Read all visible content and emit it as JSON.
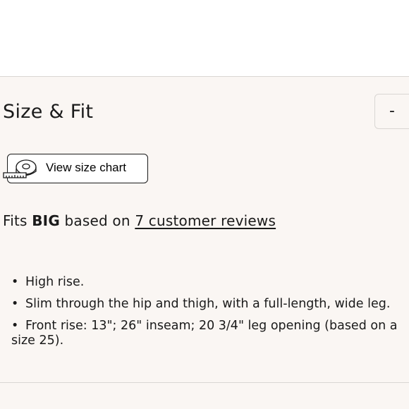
{
  "size_fit": {
    "title": "Size & Fit",
    "toggle_label": "-",
    "size_chart_button": {
      "label": "View size chart",
      "icon": "measuring-tape-icon"
    },
    "fit_summary": {
      "prefix": "Fits",
      "fit_value": "BIG",
      "middle": "based on",
      "reviews_link": "7 customer reviews"
    },
    "features": [
      "High rise.",
      "Slim through the hip and thigh, with a full-length, wide leg.",
      "Front rise: 13\"; 26\" inseam; 20 3/4\" leg opening (based on a size 25)."
    ]
  },
  "colors": {
    "panel_background": "#faf6f3",
    "divider": "#d9d6d3",
    "text": "#1a1a1a"
  }
}
